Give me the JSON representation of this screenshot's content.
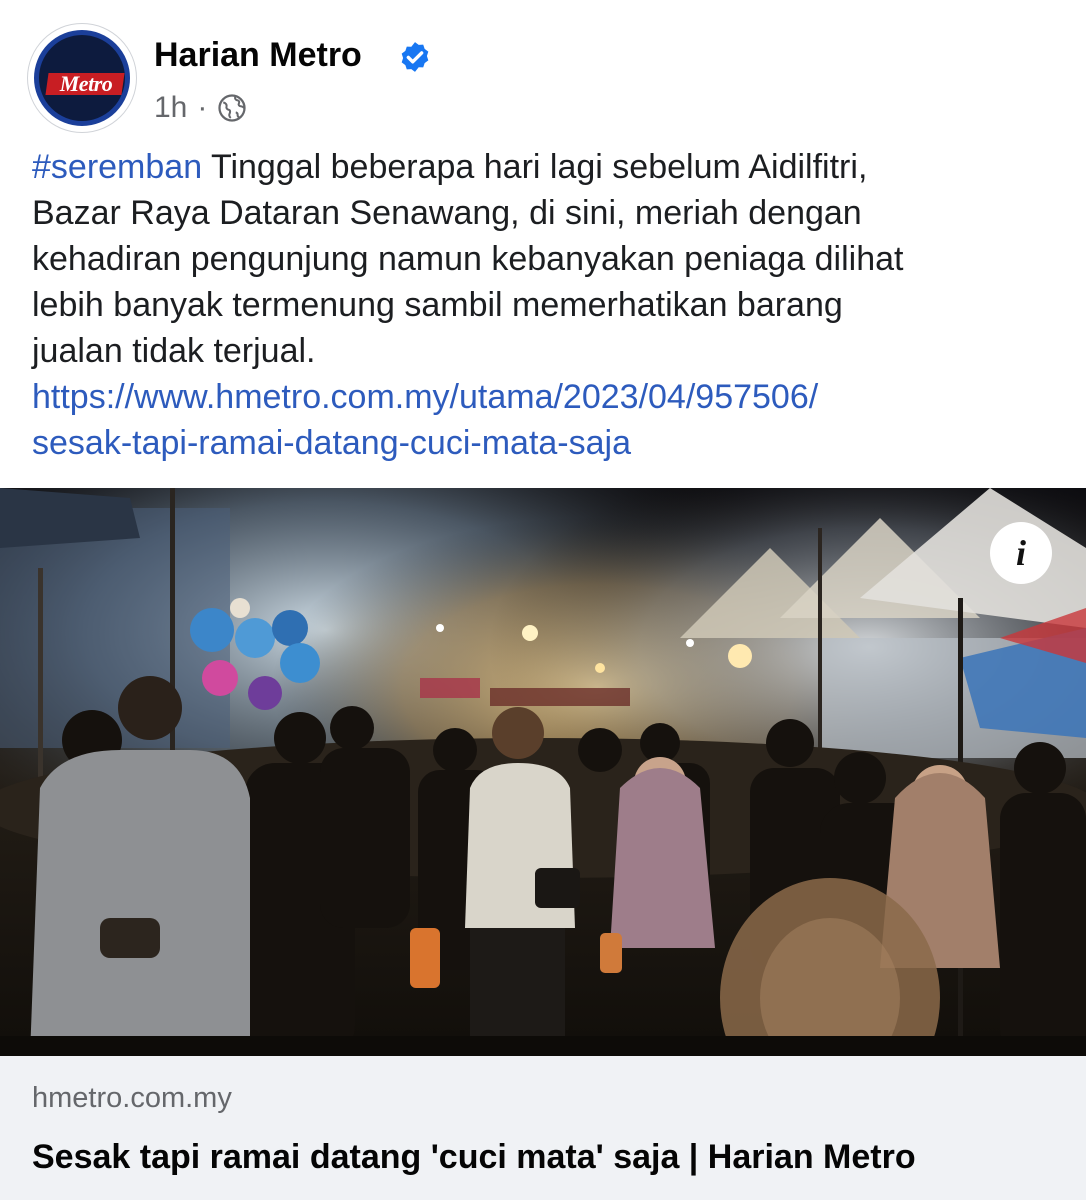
{
  "post": {
    "page_name": "Harian Metro",
    "avatar_logo_text": "Metro",
    "verified": true,
    "timestamp": "1h",
    "separator": "·",
    "audience_icon": "globe-icon",
    "hashtag": "#seremban",
    "body_lines": [
      " Tinggal beberapa hari lagi sebelum Aidilfitri,",
      "Bazar Raya Dataran Senawang, di sini, meriah dengan",
      "kehadiran pengunjung namun kebanyakan peniaga dilihat",
      "lebih banyak termenung sambil memerhatikan barang",
      "jualan tidak terjual."
    ],
    "link_lines": [
      "https://www.hmetro.com.my/utama/2023/04/957506/",
      "sesak-tapi-ramai-datang-cuci-mata-saja"
    ]
  },
  "media": {
    "info_button_label": "i",
    "alt": "night bazaar crowd"
  },
  "link_card": {
    "domain": "hmetro.com.my",
    "title": "Sesak tapi ramai datang 'cuci mata' saja | Harian Metro"
  },
  "colors": {
    "link": "#2d5bbd",
    "verified": "#1877f2",
    "secondary_text": "#65676b",
    "card_bg": "#f0f2f5"
  }
}
